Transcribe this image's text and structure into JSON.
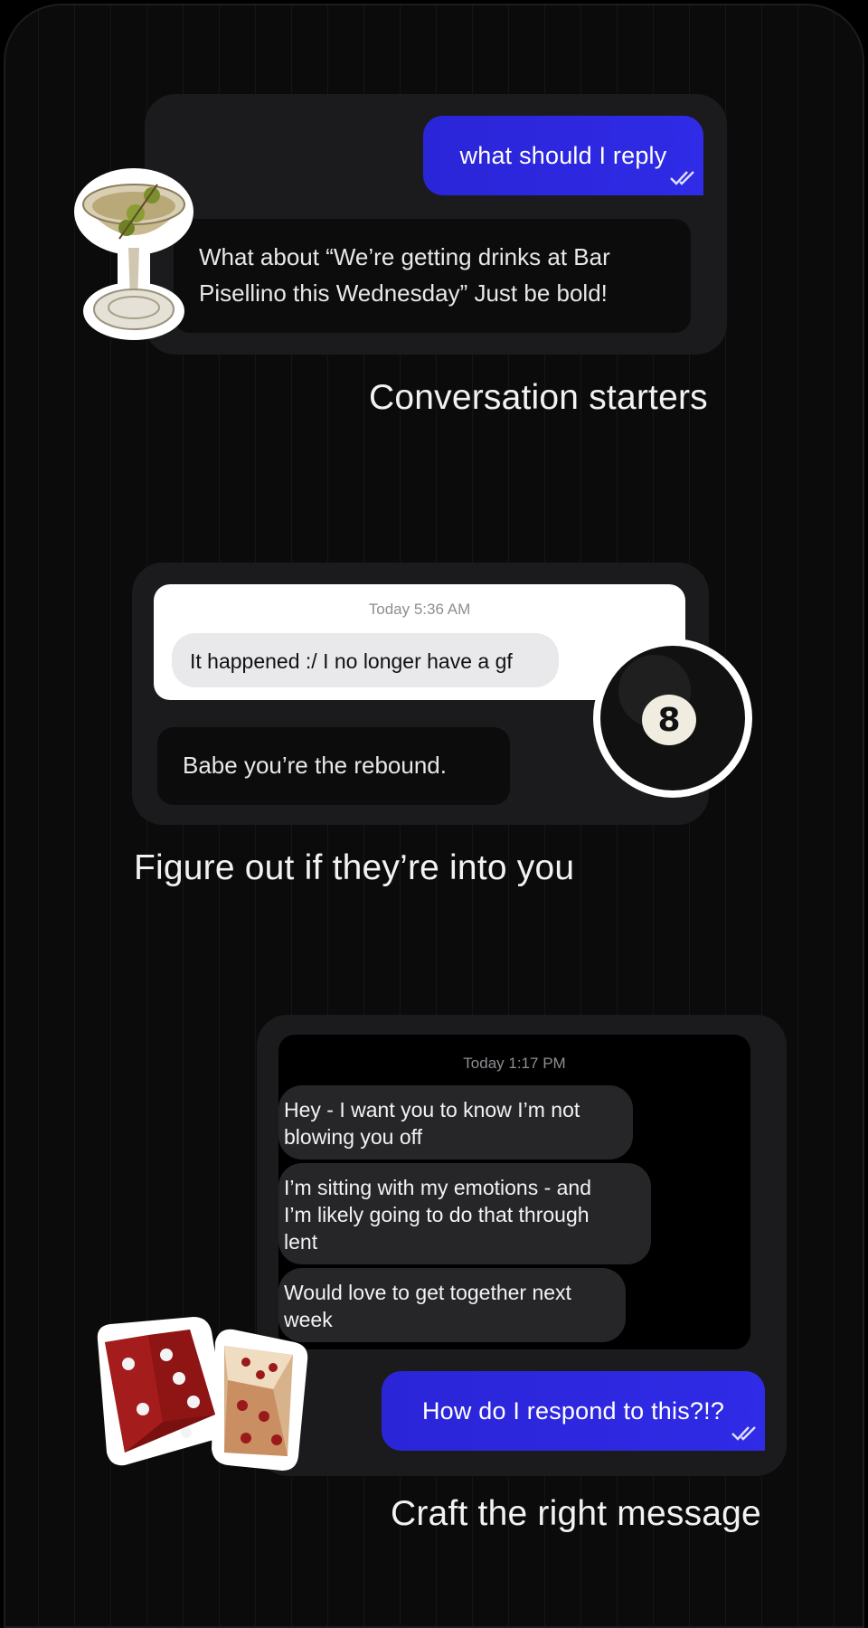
{
  "section1": {
    "user_message": "what should I reply",
    "reply_line1": "What about “We’re getting drinks at Bar",
    "reply_line2": "Pisellino this Wednesday” Just be bold!",
    "caption": "Conversation starters"
  },
  "section2": {
    "timestamp": "Today 5:36 AM",
    "received_message": "It happened :/ I no longer have a gf",
    "reply": "Babe you’re the rebound.",
    "ball_number": "8",
    "caption": "Figure out if they’re into you"
  },
  "section3": {
    "timestamp": "Today 1:17 PM",
    "messages": [
      [
        "Hey - I want you to know I’m not",
        "blowing you off"
      ],
      [
        "I’m sitting with my emotions - and",
        "I’m likely going to do that through",
        "lent"
      ],
      [
        "Would love to get together next",
        "week"
      ]
    ],
    "user_message": "How do I respond to this?!?",
    "caption": "Craft the right message"
  },
  "colors": {
    "accent_blue": "#2b25d8",
    "background": "#0b0b0c",
    "card": "#1b1b1d"
  },
  "icons": [
    "double-check-icon",
    "cocktail-glass-sticker",
    "eight-ball-sticker",
    "dice-sticker"
  ]
}
